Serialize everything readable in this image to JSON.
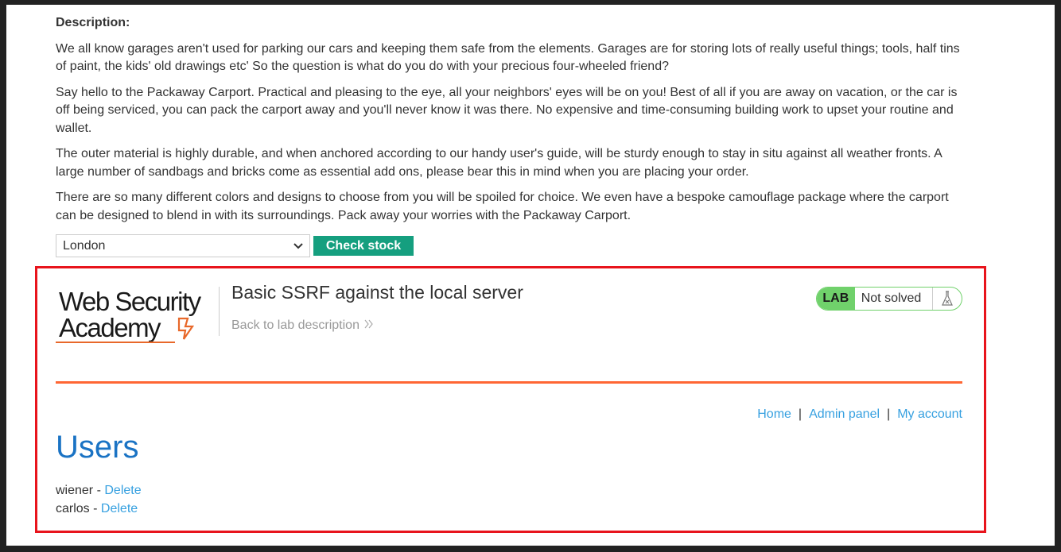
{
  "product": {
    "description_label": "Description:",
    "paragraphs": [
      "We all know garages aren't used for parking our cars and keeping them safe from the elements. Garages are for storing lots of really useful things; tools, half tins of paint, the kids' old drawings etc' So the question is what do you do with your precious four-wheeled friend?",
      "Say hello to the Packaway Carport. Practical and pleasing to the eye, all your neighbors' eyes will be on you! Best of all if you are away on vacation, or the car is off being serviced, you can pack the carport away and you'll never know it was there. No expensive and time-consuming building work to upset your routine and wallet.",
      "The outer material is highly durable, and when anchored according to our handy user's guide, will be sturdy enough to stay in situ against all weather fronts. A large number of sandbags and bricks come as essential add ons, please bear this in mind when you are placing your order.",
      "There are so many different colors and designs to choose from you will be spoiled for choice. We even have a bespoke camouflage package where the carport can be designed to blend in with its surroundings. Pack away your worries with the Packaway Carport."
    ]
  },
  "stock_check": {
    "selected_store": "London",
    "button_label": "Check stock",
    "button_color": "#159f7f"
  },
  "lab": {
    "logo_line1": "Web Security",
    "logo_line2": "Academy",
    "title": "Basic SSRF against the local server",
    "back_link": "Back to lab description",
    "status_badge": "LAB",
    "status_text": "Not solved",
    "status_color": "#70d16b",
    "accent_color": "#ff6633"
  },
  "nav": {
    "home": "Home",
    "admin_panel": "Admin panel",
    "my_account": "My account",
    "separator": "|"
  },
  "admin": {
    "heading": "Users",
    "users": [
      {
        "name": "wiener",
        "action": "Delete"
      },
      {
        "name": "carlos",
        "action": "Delete"
      }
    ],
    "dash": " - "
  },
  "highlight_color": "#e8141c"
}
